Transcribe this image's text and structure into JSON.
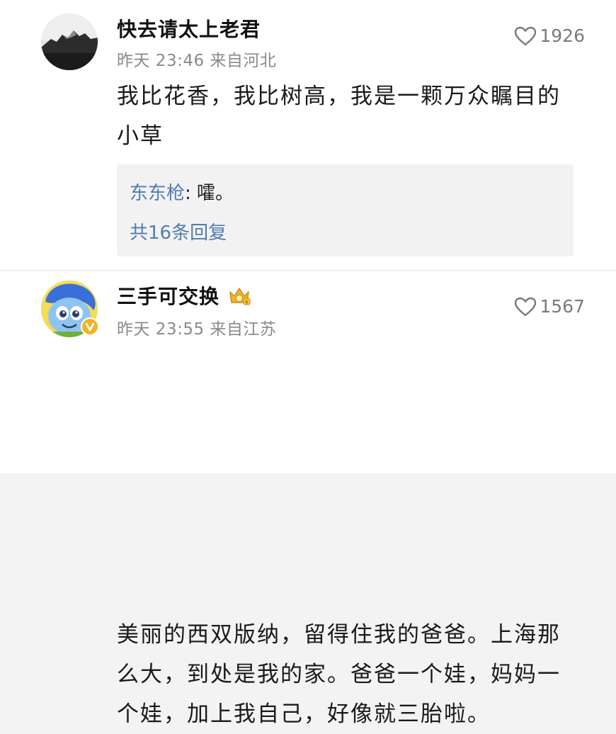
{
  "comments": [
    {
      "username": "快去请太上老君",
      "time": "昨天 23:46",
      "location": "来自河北",
      "likes": "1926",
      "text": "我比花香，我比树高，我是一颗万众瞩目的小草",
      "reply": {
        "name": "东东枪",
        "separator": ":",
        "text": "嚯。",
        "count_label": "共16条回复"
      }
    },
    {
      "username": "三手可交换",
      "time": "昨天 23:55",
      "location": "来自江苏",
      "likes": "1567",
      "text": "美丽的西双版纳，留得住我的爸爸。上海那么大，到处是我的家。爸爸一个娃，妈妈一个娃，加上我自己，好像就三胎啦。"
    }
  ],
  "icons": {
    "like": "heart-icon",
    "badge": "crown-badge-icon",
    "verified": "verified-v-icon"
  },
  "colors": {
    "link_blue": "#507daf",
    "meta_gray": "#8a8a8a",
    "badge_gold": "#f0b429"
  }
}
